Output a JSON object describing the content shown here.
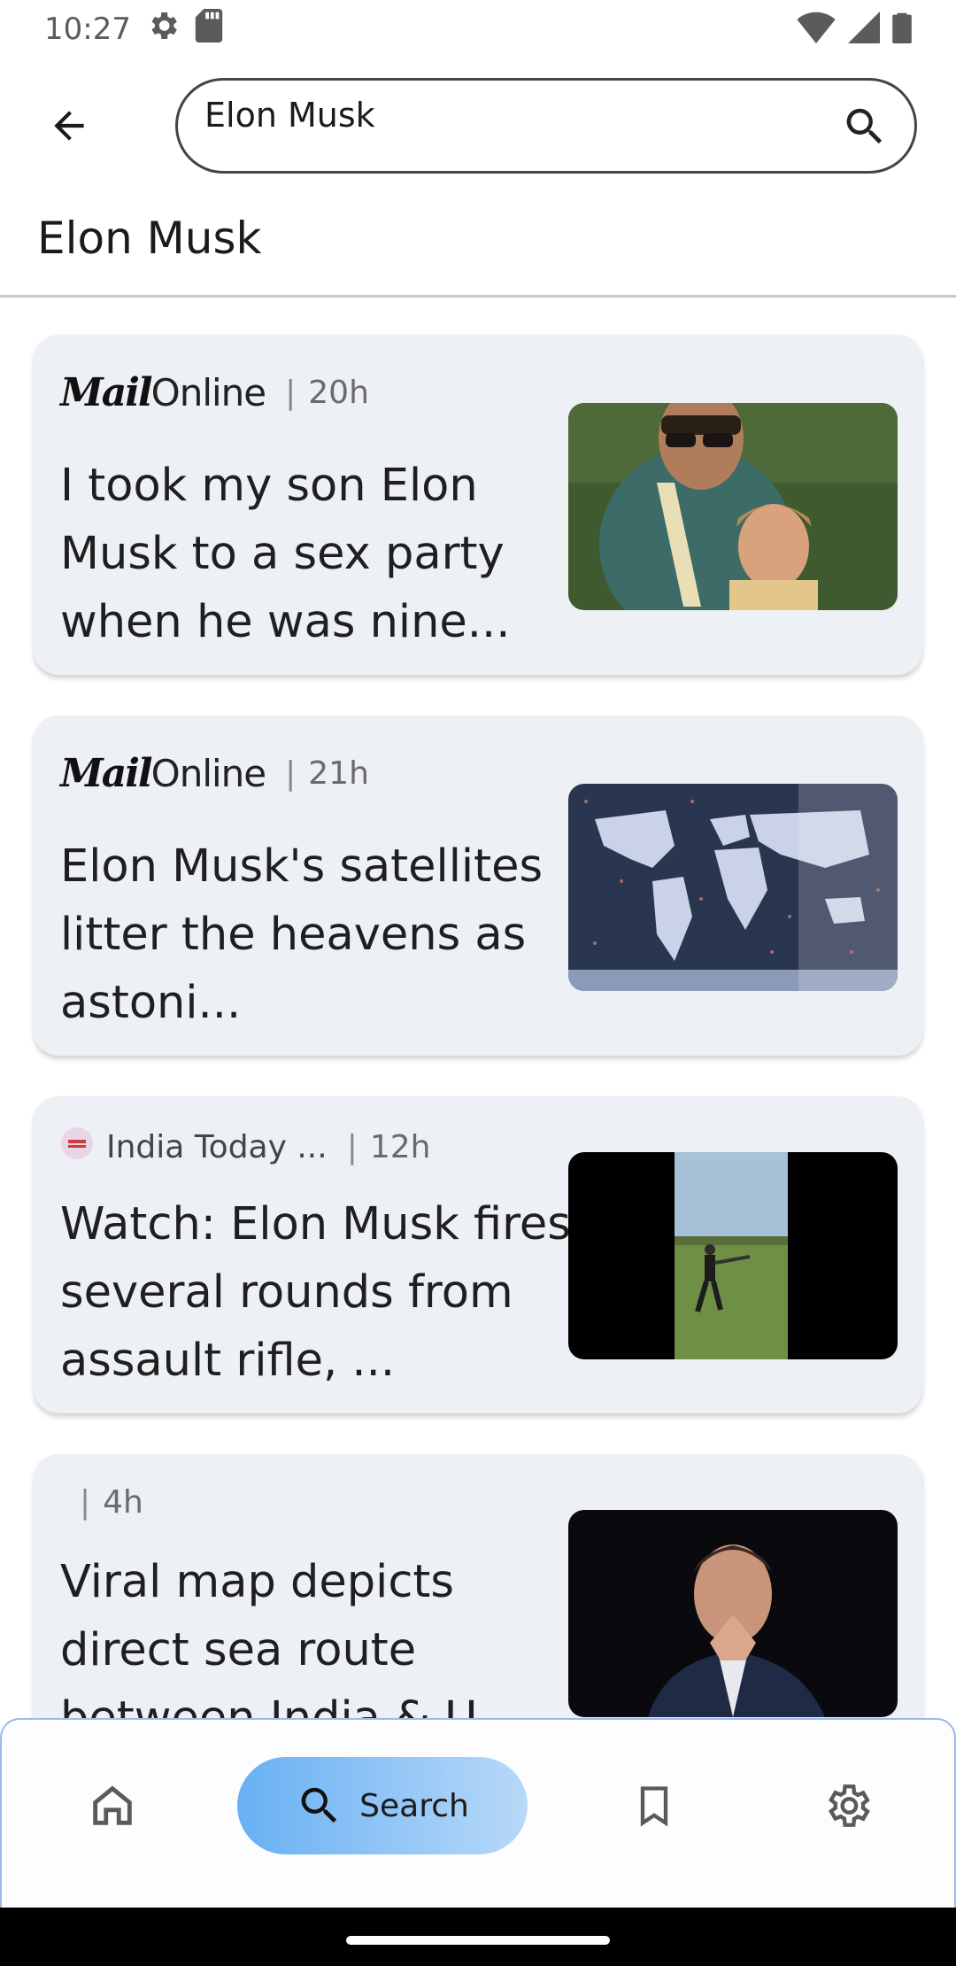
{
  "status_bar": {
    "time": "10:27"
  },
  "search": {
    "query": "Elon Musk",
    "placeholder": ""
  },
  "page_title": "Elon Musk",
  "articles": [
    {
      "source_brand": [
        "Mail",
        "Online"
      ],
      "age": "20h",
      "headline": "I took my son Elon Musk to a sex party when he was nine..."
    },
    {
      "source_brand": [
        "Mail",
        "Online"
      ],
      "age": "21h",
      "headline": "Elon Musk's satellites litter the heavens as astoni..."
    },
    {
      "source_name": "India Today ...",
      "age": "12h",
      "headline": "Watch: Elon Musk fires several rounds from assault rifle, ..."
    },
    {
      "source_name": "",
      "age": "4h",
      "headline": "Viral map depicts direct sea route between India & U..."
    }
  ],
  "bottom_nav": {
    "search_label": "Search"
  },
  "colors": {
    "accent_start": "#68b0f4",
    "accent_end": "#b8d9f8",
    "card_bg": "#edf0f4"
  }
}
